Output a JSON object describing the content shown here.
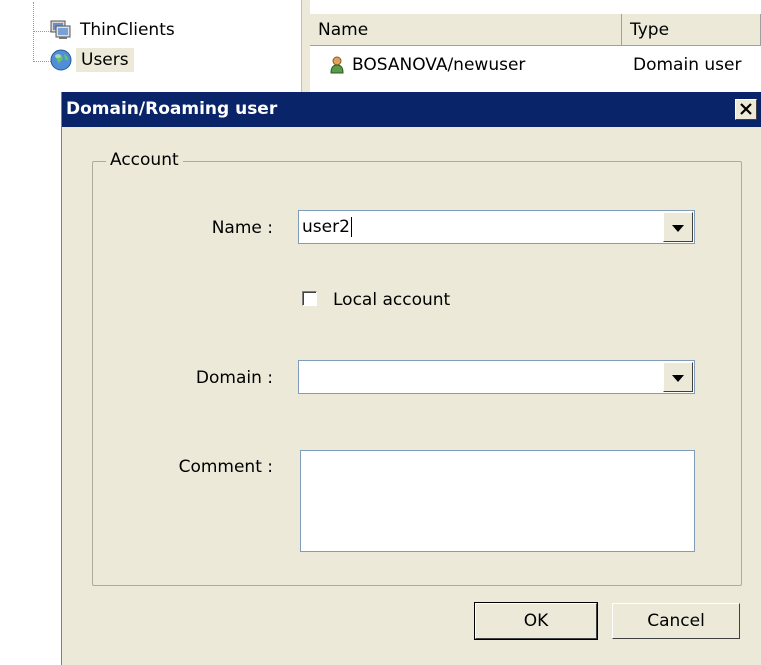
{
  "tree": {
    "items": [
      {
        "label": "ThinClients",
        "icon": "computers-icon"
      },
      {
        "label": "Users",
        "icon": "globe-icon"
      }
    ]
  },
  "list": {
    "columns": [
      "Name",
      "Type"
    ],
    "rows": [
      {
        "name": "BOSANOVA/newuser",
        "type": "Domain user",
        "icon": "user-icon"
      }
    ]
  },
  "dialog": {
    "title": "Domain/Roaming user",
    "close_glyph": "×",
    "group_label": "Account",
    "name_label": "Name :",
    "name_value": "user2",
    "local_account_label": "Local account",
    "local_account_checked": false,
    "domain_label": "Domain :",
    "domain_value": "",
    "comment_label": "Comment :",
    "comment_value": "",
    "ok_label": "OK",
    "cancel_label": "Cancel"
  },
  "colors": {
    "titlebar": "#0a246a",
    "dialog_bg": "#ece9d8"
  }
}
